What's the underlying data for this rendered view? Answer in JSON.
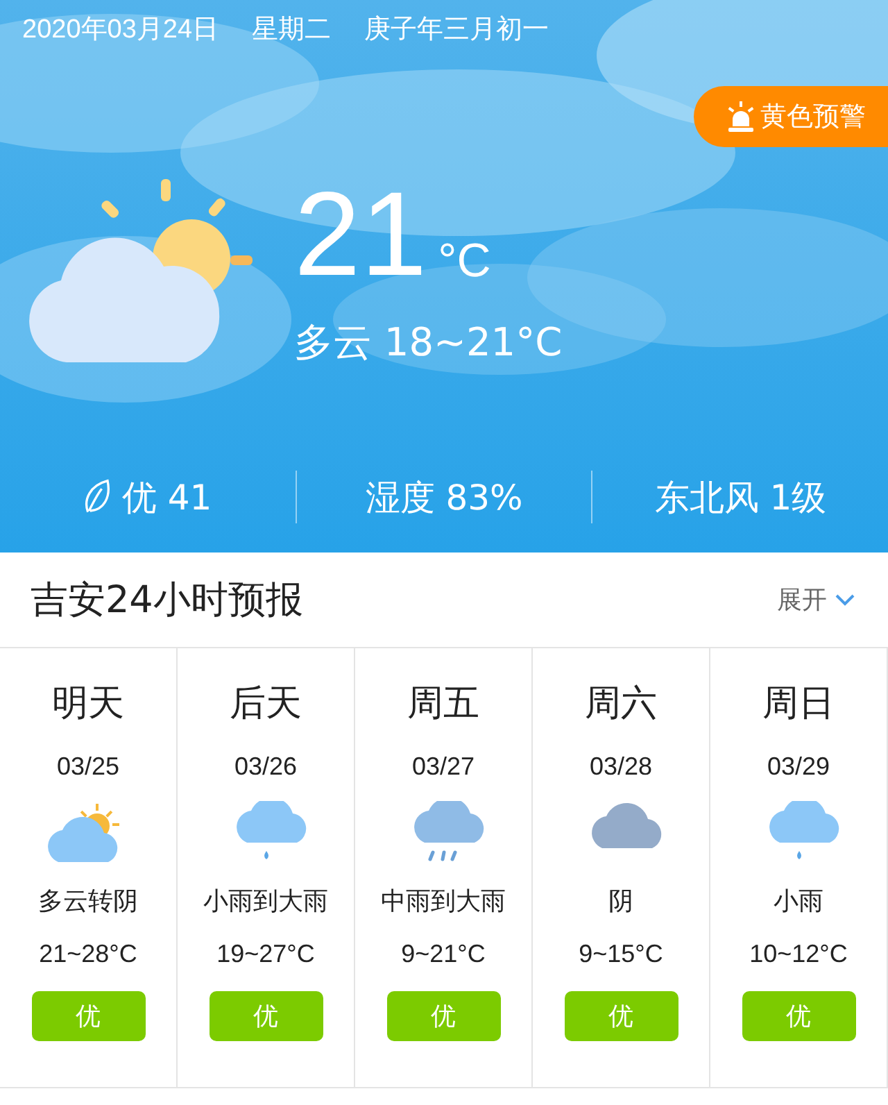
{
  "header": {
    "date": "2020年03月24日",
    "weekday": "星期二",
    "lunar": "庚子年三月初一",
    "alert": "黄色预警"
  },
  "current": {
    "kind": "partly-cloudy",
    "temperature": "21",
    "unit": "°C",
    "summary": "多云 18~21°C"
  },
  "stats": [
    {
      "kind": "air",
      "text": "优 41"
    },
    {
      "kind": "plain",
      "text": "湿度 83%"
    },
    {
      "kind": "plain",
      "text": "东北风 1级"
    }
  ],
  "forecast_header": {
    "title": "吉安24小时预报",
    "toggle": "展开"
  },
  "days": [
    {
      "day": "明天",
      "date": "03/25",
      "kind": "partly-cloudy",
      "condition": "多云转阴",
      "range": "21~28°C",
      "aqi": "优"
    },
    {
      "day": "后天",
      "date": "03/26",
      "kind": "light-rain",
      "condition": "小雨到大雨",
      "range": "19~27°C",
      "aqi": "优"
    },
    {
      "day": "周五",
      "date": "03/27",
      "kind": "moderate-rain",
      "condition": "中雨到大雨",
      "range": "9~21°C",
      "aqi": "优"
    },
    {
      "day": "周六",
      "date": "03/28",
      "kind": "overcast",
      "condition": "阴",
      "range": "9~15°C",
      "aqi": "优"
    },
    {
      "day": "周日",
      "date": "03/29",
      "kind": "light-rain",
      "condition": "小雨",
      "range": "10~12°C",
      "aqi": "优"
    }
  ]
}
